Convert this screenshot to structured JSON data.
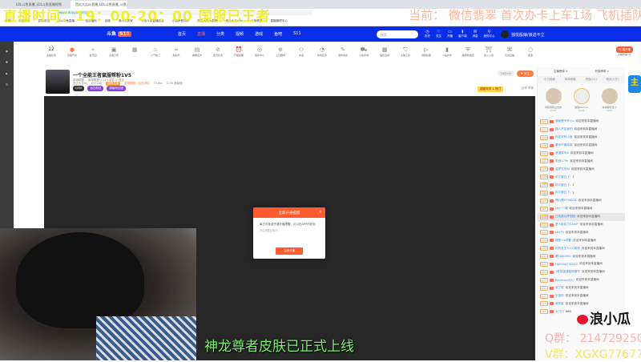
{
  "browser": {
    "tabs": [
      "LOL斗鱼直播_LOL斗鱼直播视频",
      "西瓜大瓜ss直播_LOL斗鱼直播_斗鱼"
    ],
    "url": "www.douyu.com/...",
    "bookmarks": [
      "收藏",
      "西瓜大瓜",
      "直播设置",
      "LOL斗鱼直播...",
      "哈芬福利",
      "百度",
      "浪小瓜的家",
      "斗鱼斗鱼直播后台",
      "小鹅声音同步",
      "西瓜大瓜ss直播",
      "西瓜大瓜wiki",
      "斗鱼联盟",
      "直播管理中心"
    ]
  },
  "overlay": {
    "schedule": "直播时间：19：00-20：00  国服已王者",
    "current": "当前：  微信翡翠  首次办卡上车1场 飞机插队",
    "subtitle": "神龙尊者皮肤已正式上线",
    "watermark": "浪小瓜",
    "qq_group": "Q群：  214729250",
    "wx_group": "V群：XGXG77677"
  },
  "nav": {
    "logo": "斗鱼",
    "logo_badge": "S11",
    "links": [
      "首页",
      "直播",
      "分类",
      "视频",
      "游戏",
      "鱼吧",
      "S11"
    ],
    "search_placeholder": "搜索",
    "icons": [
      "历史",
      "关注",
      "开播",
      "客户端",
      "消息",
      "我的中心"
    ],
    "user": "独悦般娘/浪迹不立"
  },
  "categories": [
    "主播任务",
    "直播开关",
    "鱼乐园",
    "主播日历",
    "",
    "人气热门",
    "拍拍乐",
    "看看任务",
    "金币任务",
    "开播提醒",
    "我的中心",
    "上门器材",
    "友谊",
    "热榜任务",
    "发布动态",
    "小鱼商城",
    "福利活动",
    "主播工具",
    "视频投票",
    "斗鱼伙伴",
    "超级粉丝团",
    "加入公会",
    "互动直播",
    "更多"
  ],
  "pc_button": "PC端开播",
  "pc_sub": "主播的第1天",
  "room": {
    "title": "一个全能王者鼠服帮粉1V5",
    "category": "英雄联盟",
    "tags": "英雄联盟 > LOL全能 > 西瓜",
    "streamer": "西瓜大瓜ss",
    "hot": "809168",
    "level": "金牌主播",
    "tag2": "英雄联盟 - 钻石排位",
    "fans": "75.8w",
    "weekly": "1230 贡献值",
    "badges": [
      "LV50",
      "钻石粉丝",
      "超级粉丝团"
    ],
    "fans_btn": "100100",
    "follow": "关注",
    "rank": "超级对决 1 热门",
    "share": "分享",
    "report": "举报"
  },
  "modal": {
    "title": "立即开通提醒",
    "body": "每日可免费开通开播提醒，可以在APP内收到",
    "hint": "开启提醒后每日...",
    "button": "立即开通"
  },
  "chat": {
    "top": [
      "主播榜单 >",
      "贵族榜单 >"
    ],
    "tabs": [
      "今日贡献",
      "本周贡献",
      "贵族(10)",
      "粉丝(2万)"
    ],
    "top_fans": [
      {
        "name": "风吹风吹过去的",
        "lv": "LV35",
        "gold": false
      },
      {
        "name": "独悦Damon",
        "lv": "LV36",
        "gold": true
      },
      {
        "name": "棒棒糖可爱小",
        "lv": "LV35",
        "gold": false
      }
    ],
    "messages": [
      {
        "lv": "LV7",
        "name": "我就是不开心z",
        "text": "欢迎来到本直播间"
      },
      {
        "lv": "LV7",
        "name": "路人不如我的",
        "text": "欢迎来到本直播间"
      },
      {
        "lv": "LV20",
        "name": "你还好吗小鱼",
        "text": "欢迎来到本直播间"
      },
      {
        "lv": "LV8",
        "name": "看你不服你能",
        "text": "欢迎来到本直播间"
      },
      {
        "lv": "LV15",
        "name": "浪漫菜鸟A",
        "text": "欢迎来到本直播间"
      },
      {
        "lv": "LV7",
        "name": "张西179n",
        "text": "欢迎来到本直播间"
      },
      {
        "lv": "LV7",
        "name": "温梦无双AI",
        "text": "欢迎来到本直播间"
      },
      {
        "lv": "LV16",
        "name": "你又被白了:",
        "text": "1"
      },
      {
        "lv": "LV16",
        "name": "你又被白了:",
        "text": "1"
      },
      {
        "lv": "LV16",
        "name": "你又被白了:",
        "text": "1"
      },
      {
        "lv": "LV7",
        "name": "嘿心情9706211",
        "text": "欢迎来到本直播间"
      },
      {
        "lv": "LV7",
        "name": "sky~~雷",
        "text": "欢迎来到本直播间"
      },
      {
        "lv": "LV36",
        "name": "白色新月梦丽园",
        "text": "欢迎来到本直播间",
        "hl": true
      },
      {
        "lv": "LV20",
        "name": "恶人真实力SAmR",
        "text": "欢迎来到本直播间"
      },
      {
        "lv": "LV7",
        "name": "sku73",
        "text": "欢迎来到本直播间"
      },
      {
        "lv": "LV16",
        "name": "哪座～o溯影",
        "text": "欢迎来到本直播间"
      },
      {
        "lv": "LV20",
        "name": "你的老友?(1)0英雄",
        "text": "欢迎来到本直播间"
      },
      {
        "lv": "LV13",
        "name": "看1440500",
        "text": "欢迎来到本直播间"
      },
      {
        "lv": "LV7",
        "name": "Fighting132015",
        "text": "欢迎来到本直播间"
      },
      {
        "lv": "LV13",
        "name": "1秒怒英雄破碎魔华",
        "text": "欢迎来到本直播间"
      },
      {
        "lv": "LV7",
        "name": "Redmoon537",
        "text": "欢迎来到本直播间"
      },
      {
        "lv": "LV10",
        "name": "来了呀",
        "text": "欢迎来到本直播间"
      },
      {
        "lv": "LV7",
        "name": "宇宙的",
        "text": "欢迎来到本直播间"
      },
      {
        "lv": "LV7",
        "name": "我的星",
        "text": "欢迎来到本直播间"
      },
      {
        "lv": "LV7",
        "name": "大门口",
        "text": "666"
      }
    ]
  }
}
